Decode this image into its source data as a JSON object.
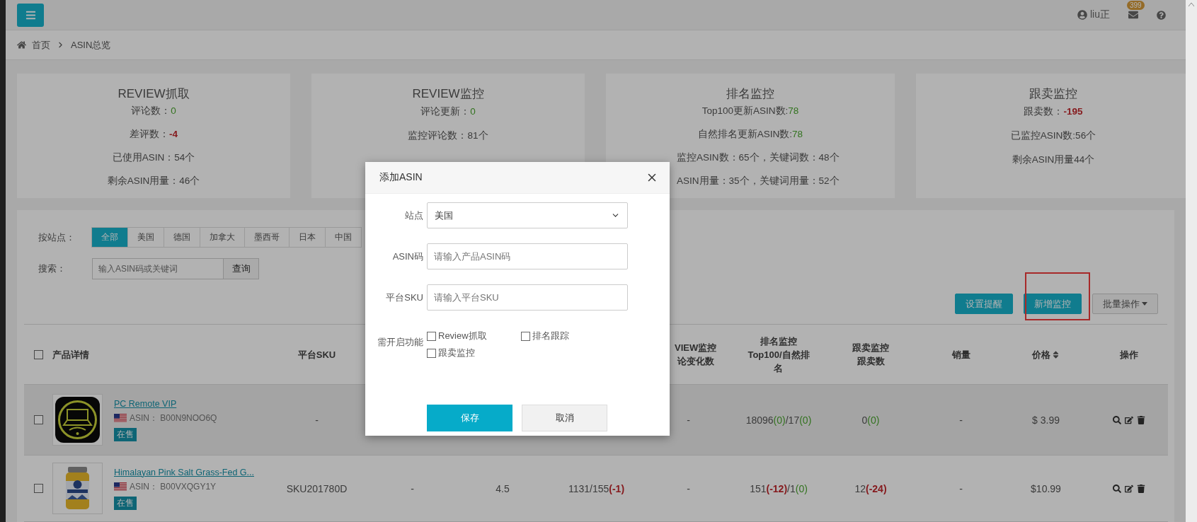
{
  "topbar": {
    "user": "liu正",
    "badge": "399"
  },
  "breadcrumb": [
    "首页",
    "ASIN总览"
  ],
  "cards": [
    {
      "title": "REVIEW抓取",
      "lines": [
        {
          "label": "评论数：",
          "value": "0",
          "kind": "up"
        },
        {
          "label": "差评数：",
          "value": "-4",
          "kind": "down"
        },
        {
          "label": "已使用ASIN：54个"
        },
        {
          "label": "剩余ASIN用量：46个"
        }
      ]
    },
    {
      "title": "REVIEW监控",
      "lines": [
        {
          "label": "评论更新：",
          "value": "0",
          "kind": "up"
        },
        {
          "label": "监控评论数：81个"
        }
      ]
    },
    {
      "title": "排名监控",
      "lines": [
        {
          "label": "Top100更新ASIN数:",
          "value": "78",
          "kind": "up"
        },
        {
          "label": "自然排名更新ASIN数:",
          "value": "78",
          "kind": "up"
        },
        {
          "label": "监控ASIN数：65个，关键词数：48个",
          "cut": true
        },
        {
          "label": "ASIN用量：35个，关键词用量：52个",
          "cut": true
        }
      ]
    },
    {
      "title": "跟卖监控",
      "lines": [
        {
          "label": "跟卖数：",
          "value": "-195",
          "kind": "down"
        },
        {
          "label": "已监控ASIN数:56个"
        },
        {
          "label": "剩余ASIN用量44个"
        }
      ]
    }
  ],
  "filters": {
    "site_label": "按站点：",
    "sites": [
      {
        "label": "全部",
        "selected": true
      },
      {
        "label": "美国",
        "selected": false
      },
      {
        "label": "德国",
        "selected": false
      },
      {
        "label": "加拿大",
        "selected": false
      },
      {
        "label": "墨西哥",
        "selected": false
      },
      {
        "label": "日本",
        "selected": false
      },
      {
        "label": "中国",
        "selected": false
      }
    ],
    "search_label": "搜索：",
    "search_placeholder": "输入ASIN码或关键词",
    "search_button": "查询"
  },
  "toolbar": [
    {
      "label": "设置提醒",
      "kind": "primary",
      "highlighted": false
    },
    {
      "label": "新增监控",
      "kind": "primary",
      "highlighted": true
    },
    {
      "label": "批量操作",
      "kind": "dropdown",
      "highlighted": false
    }
  ],
  "table": {
    "header_checked": false,
    "columns": [
      [
        "产品详情"
      ],
      [
        "平台SKU"
      ],
      "",
      "",
      "",
      [
        "VIEW监控",
        "论变化数"
      ],
      [
        "排名监控",
        "Top100/自然排",
        "名"
      ],
      [
        "跟卖监控",
        "跟卖数"
      ],
      [
        "销量"
      ],
      [
        "价格"
      ],
      [
        "操作"
      ]
    ],
    "rows": [
      {
        "checked": false,
        "hover": true,
        "cells": [
          {
            "name": "PC Remote VIP",
            "asin_label": "ASIN：",
            "asin": "B00N9NOO6Q",
            "status": "在售"
          },
          "-",
          "",
          "",
          "",
          "-",
          [
            {
              "text": "18096"
            },
            {
              "text": "(0)",
              "kind": "up"
            },
            {
              "text": "/17"
            },
            {
              "text": "(0)",
              "kind": "up"
            }
          ],
          [
            {
              "text": "0"
            },
            {
              "text": "(0)",
              "kind": "up"
            }
          ],
          "-",
          "$ 3.99"
        ]
      },
      {
        "checked": false,
        "hover": false,
        "cells": [
          {
            "name": "Himalayan Pink Salt Grass-Fed G...",
            "asin_label": "ASIN：",
            "asin": "B00VXQGY1Y",
            "status": "在售"
          },
          "SKU201780D",
          "-",
          "4.5",
          [
            {
              "text": "1131/155"
            },
            {
              "text": "(-1)",
              "kind": "down"
            }
          ],
          "-",
          [
            {
              "text": "151"
            },
            {
              "text": "(-12)",
              "kind": "down"
            },
            {
              "text": "/1"
            },
            {
              "text": "(0)",
              "kind": "up"
            }
          ],
          [
            {
              "text": "12"
            },
            {
              "text": "(-24)",
              "kind": "down"
            }
          ],
          "-",
          "$10.99"
        ]
      }
    ]
  },
  "modal": {
    "title": "添加ASIN",
    "fields": [
      {
        "label": "站点",
        "kind": "select",
        "value": "美国"
      },
      {
        "label": "ASIN码",
        "kind": "text",
        "placeholder": "请输入产品ASIN码"
      },
      {
        "label": "平台SKU",
        "kind": "text",
        "placeholder": "请输入平台SKU"
      }
    ],
    "features_label": "需开启功能",
    "features": [
      {
        "label": "Review抓取",
        "checked": false
      },
      {
        "label": "排名跟踪",
        "checked": false
      },
      {
        "label": "跟卖监控",
        "checked": false
      }
    ],
    "buttons": [
      {
        "label": "保存",
        "kind": "primary"
      },
      {
        "label": "取消",
        "kind": "default"
      }
    ]
  }
}
